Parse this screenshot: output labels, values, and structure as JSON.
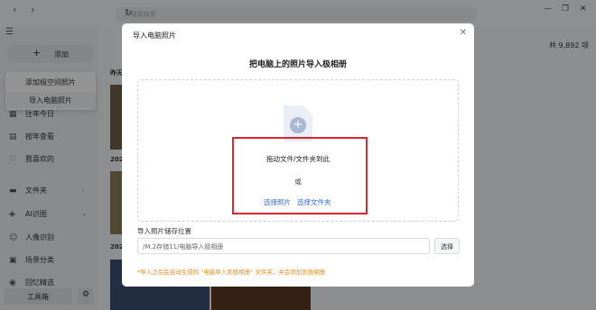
{
  "app": {
    "search_placeholder": "AI智能搜索",
    "add_label": "添加",
    "menu": {
      "add_space_photos": "添加极空间照片",
      "import_pc_photos": "导入电脑照片"
    },
    "sidebar": {
      "items": [
        {
          "label": "往年今日",
          "icon": "calendar-icon"
        },
        {
          "label": "按年查看",
          "icon": "book-icon"
        },
        {
          "label": "我喜欢的",
          "icon": "heart-icon"
        },
        {
          "label": "文件夹",
          "icon": "folder-icon"
        },
        {
          "label": "AI识图",
          "icon": "ai-icon"
        },
        {
          "label": "人像识别",
          "icon": "face-icon"
        },
        {
          "label": "场景分类",
          "icon": "scene-icon"
        },
        {
          "label": "回忆精选",
          "icon": "memory-icon"
        }
      ],
      "tools_label": "工具箱"
    },
    "total_count": "共 9,892 项",
    "date_labels": [
      "昨天",
      "202",
      "202",
      "202"
    ]
  },
  "modal": {
    "title": "导入电脑照片",
    "heading": "把电脑上的照片导入极相册",
    "drag_text": "拖动文件/文件夹到此",
    "or_text": "或",
    "select_photos": "选择照片",
    "select_folder": "选择文件夹",
    "store_label": "导入照片储存位置",
    "store_path": "/M.2存储11/电脑导入极相册",
    "choose_button": "选择",
    "note": "*导入之后会自动生成的 \"电脑导入到极相册\" 文件夹，并会添加到极相册"
  },
  "colors": {
    "link": "#2f6fd6",
    "highlight_box": "#e0262b",
    "note": "#e88a1a"
  }
}
